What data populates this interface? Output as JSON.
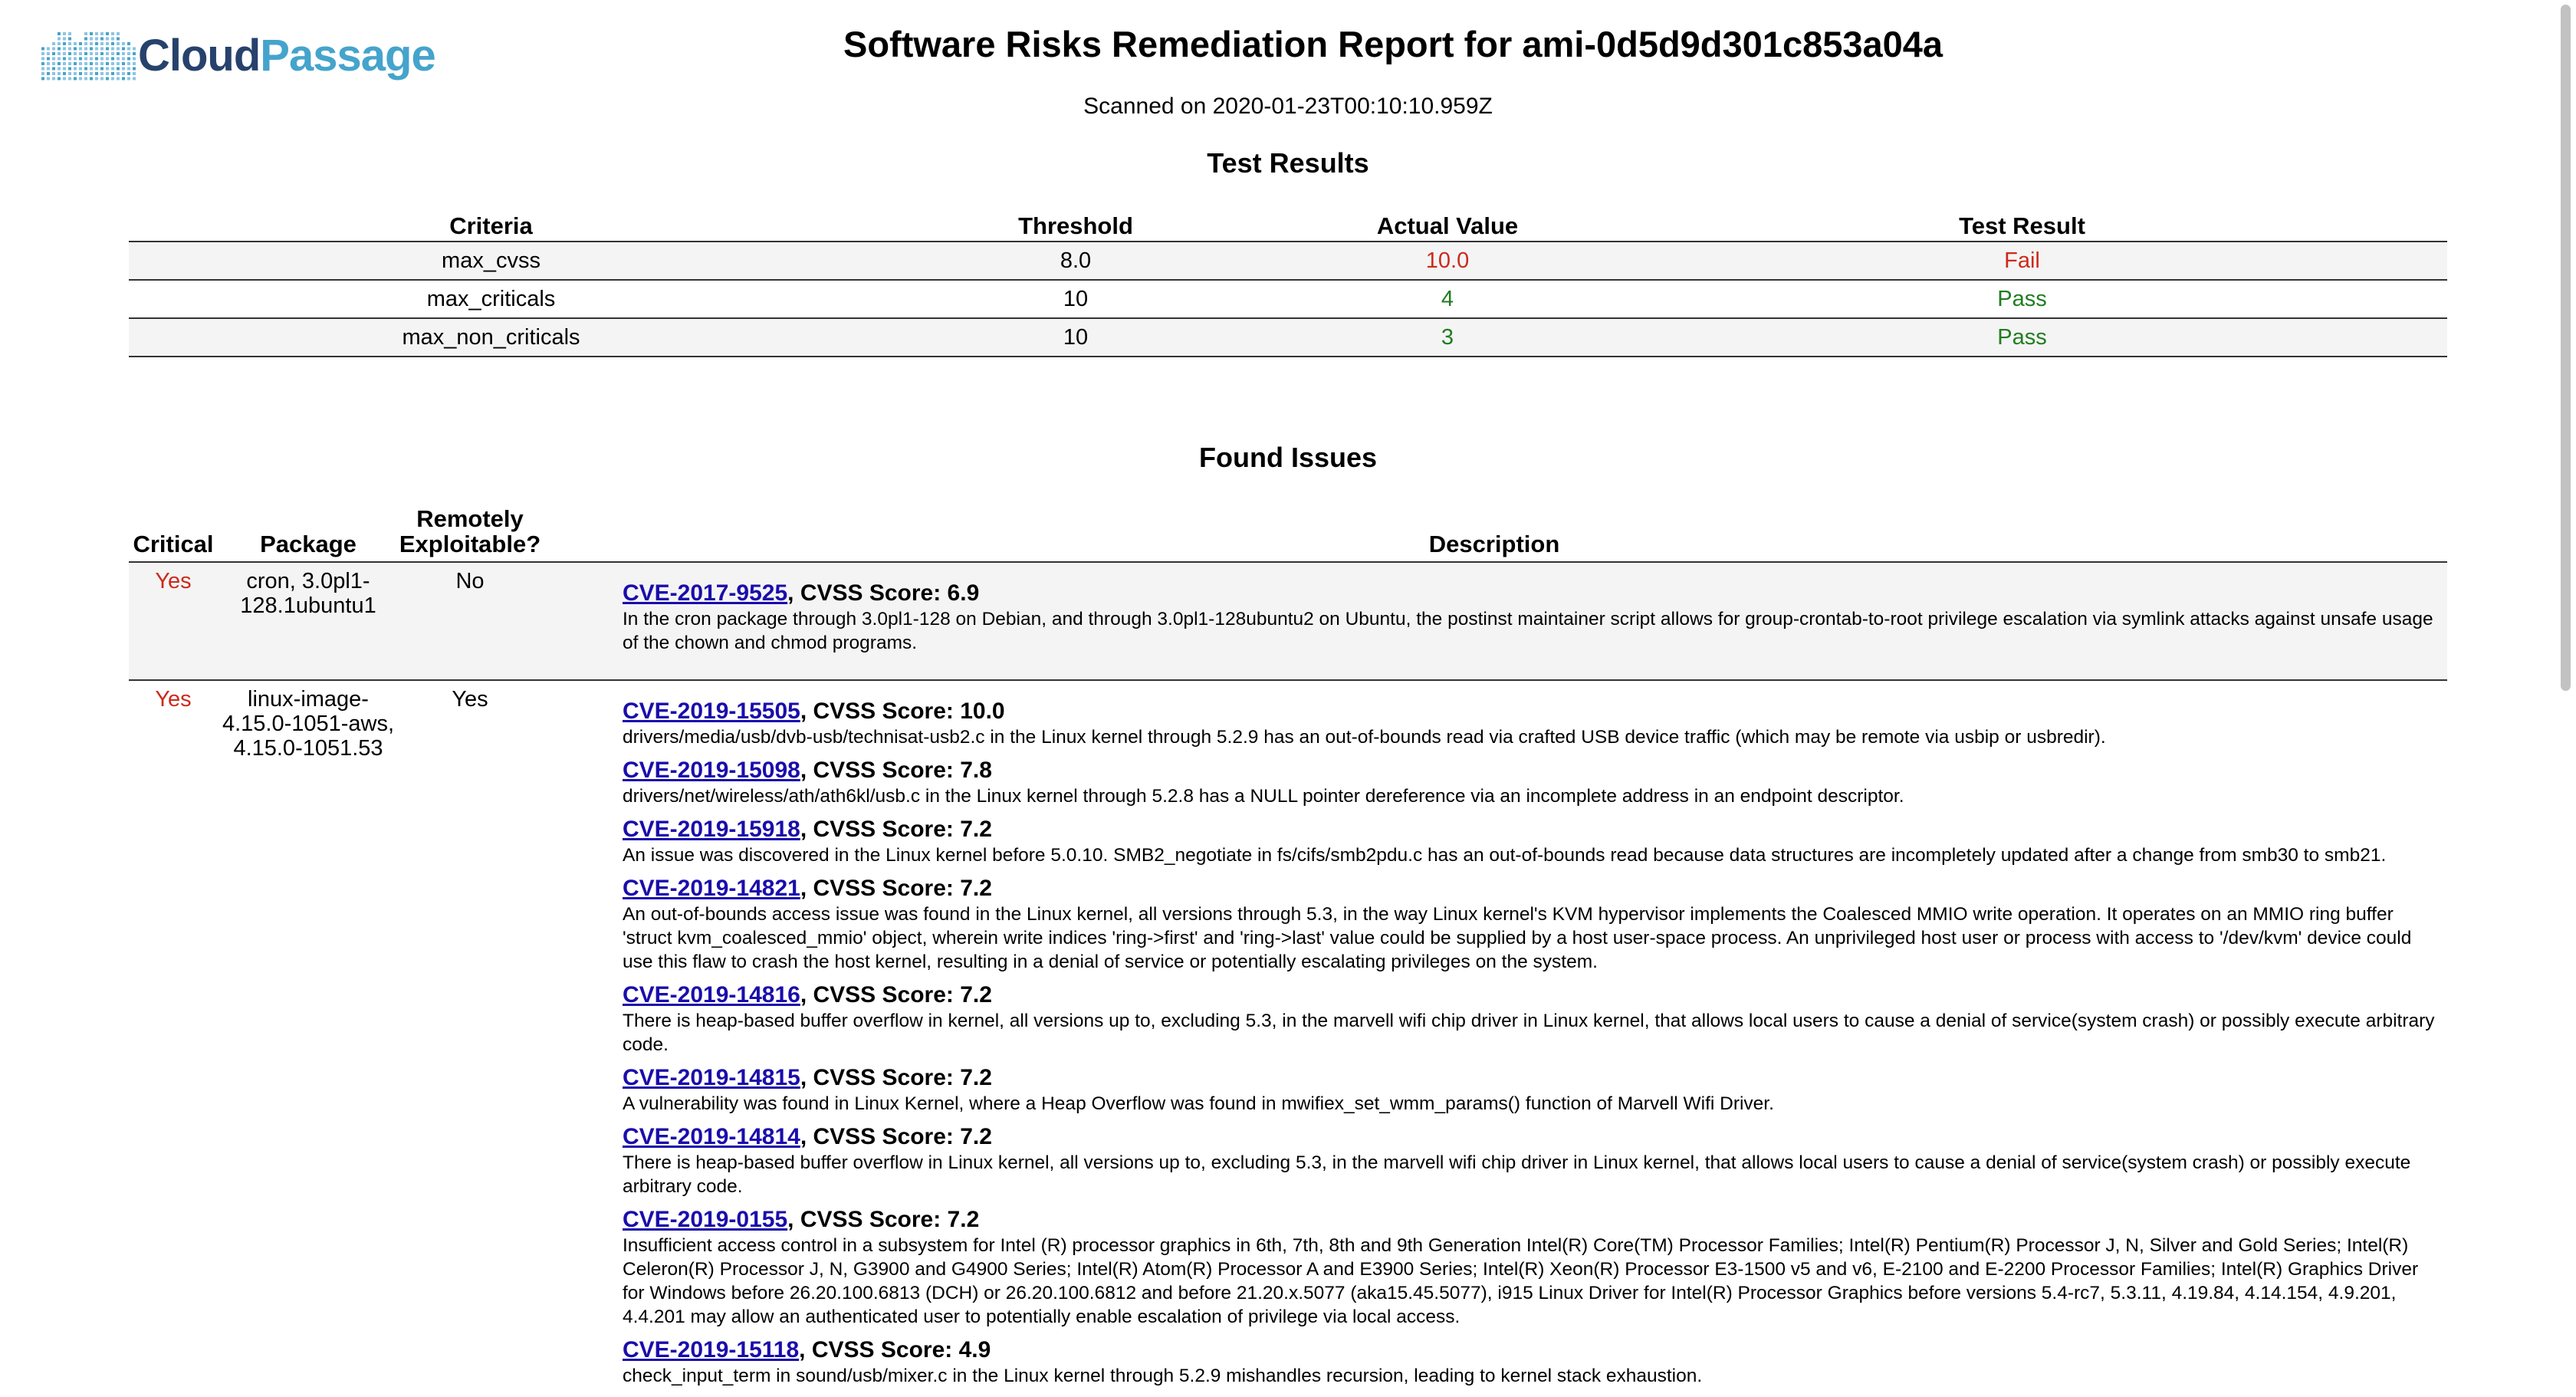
{
  "header": {
    "logo": {
      "icon": "cloud-dots-logo",
      "cloud_text": "Cloud",
      "passage_text": "Passage"
    },
    "title": "Software Risks Remediation Report for ami-0d5d9d301c853a04a",
    "scanned": "Scanned on 2020-01-23T00:10:10.959Z"
  },
  "test_results": {
    "heading": "Test Results",
    "columns": [
      "Criteria",
      "Threshold",
      "Actual Value",
      "Test Result"
    ],
    "rows": [
      {
        "criteria": "max_cvss",
        "threshold": "8.0",
        "actual": "10.0",
        "result": "Fail",
        "status_color": "#cc2a1b"
      },
      {
        "criteria": "max_criticals",
        "threshold": "10",
        "actual": "4",
        "result": "Pass",
        "status_color": "#1f7d1f"
      },
      {
        "criteria": "max_non_criticals",
        "threshold": "10",
        "actual": "3",
        "result": "Pass",
        "status_color": "#1f7d1f"
      }
    ]
  },
  "found_issues": {
    "heading": "Found Issues",
    "columns": [
      "Critical",
      "Package",
      "Remotely Exploitable?",
      "Description"
    ],
    "rows": [
      {
        "critical": "Yes",
        "package": "cron, 3.0pl1-128.1ubuntu1",
        "remote": "No",
        "cves": [
          {
            "id": "CVE-2017-9525",
            "score_text": ", CVSS Score: 6.9",
            "text": "In the cron package through 3.0pl1-128 on Debian, and through 3.0pl1-128ubuntu2 on Ubuntu, the postinst maintainer script allows for group-crontab-to-root privilege escalation via symlink attacks against unsafe usage of the chown and chmod programs."
          }
        ]
      },
      {
        "critical": "Yes",
        "package": "linux-image-4.15.0-1051-aws, 4.15.0-1051.53",
        "remote": "Yes",
        "cves": [
          {
            "id": "CVE-2019-15505",
            "score_text": ", CVSS Score: 10.0",
            "text": "drivers/media/usb/dvb-usb/technisat-usb2.c in the Linux kernel through 5.2.9 has an out-of-bounds read via crafted USB device traffic (which may be remote via usbip or usbredir)."
          },
          {
            "id": "CVE-2019-15098",
            "score_text": ", CVSS Score: 7.8",
            "text": "drivers/net/wireless/ath/ath6kl/usb.c in the Linux kernel through 5.2.8 has a NULL pointer dereference via an incomplete address in an endpoint descriptor."
          },
          {
            "id": "CVE-2019-15918",
            "score_text": ", CVSS Score: 7.2",
            "text": "An issue was discovered in the Linux kernel before 5.0.10. SMB2_negotiate in fs/cifs/smb2pdu.c has an out-of-bounds read because data structures are incompletely updated after a change from smb30 to smb21."
          },
          {
            "id": "CVE-2019-14821",
            "score_text": ", CVSS Score: 7.2",
            "text": "An out-of-bounds access issue was found in the Linux kernel, all versions through 5.3, in the way Linux kernel's KVM hypervisor implements the Coalesced MMIO write operation. It operates on an MMIO ring buffer 'struct kvm_coalesced_mmio' object, wherein write indices 'ring->first' and 'ring->last' value could be supplied by a host user-space process. An unprivileged host user or process with access to '/dev/kvm' device could use this flaw to crash the host kernel, resulting in a denial of service or potentially escalating privileges on the system."
          },
          {
            "id": "CVE-2019-14816",
            "score_text": ", CVSS Score: 7.2",
            "text": "There is heap-based buffer overflow in kernel, all versions up to, excluding 5.3, in the marvell wifi chip driver in Linux kernel, that allows local users to cause a denial of service(system crash) or possibly execute arbitrary code."
          },
          {
            "id": "CVE-2019-14815",
            "score_text": ", CVSS Score: 7.2",
            "text": "A vulnerability was found in Linux Kernel, where a Heap Overflow was found in mwifiex_set_wmm_params() function of Marvell Wifi Driver."
          },
          {
            "id": "CVE-2019-14814",
            "score_text": ", CVSS Score: 7.2",
            "text": "There is heap-based buffer overflow in Linux kernel, all versions up to, excluding 5.3, in the marvell wifi chip driver in Linux kernel, that allows local users to cause a denial of service(system crash) or possibly execute arbitrary code."
          },
          {
            "id": "CVE-2019-0155",
            "score_text": ", CVSS Score: 7.2",
            "text": "Insufficient access control in a subsystem for Intel (R) processor graphics in 6th, 7th, 8th and 9th Generation Intel(R) Core(TM) Processor Families; Intel(R) Pentium(R) Processor J, N, Silver and Gold Series; Intel(R) Celeron(R) Processor J, N, G3900 and G4900 Series; Intel(R) Atom(R) Processor A and E3900 Series; Intel(R) Xeon(R) Processor E3-1500 v5 and v6, E-2100 and E-2200 Processor Families; Intel(R) Graphics Driver for Windows before 26.20.100.6813 (DCH) or 26.20.100.6812 and before 21.20.x.5077 (aka15.45.5077), i915 Linux Driver for Intel(R) Processor Graphics before versions 5.4-rc7, 5.3.11, 4.19.84, 4.14.154, 4.9.201, 4.4.201 may allow an authenticated user to potentially enable escalation of privilege via local access."
          },
          {
            "id": "CVE-2019-15118",
            "score_text": ", CVSS Score: 4.9",
            "text": "check_input_term in sound/usb/mixer.c in the Linux kernel through 5.2.9 mishandles recursion, leading to kernel stack exhaustion."
          }
        ]
      }
    ]
  }
}
